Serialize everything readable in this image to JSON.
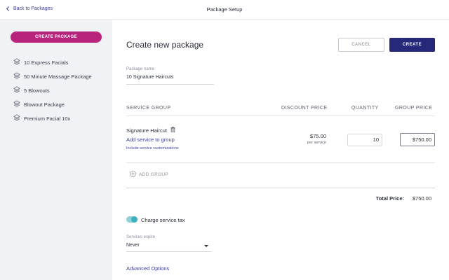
{
  "topbar": {
    "back_label": "Back to Packages",
    "title": "Package Setup"
  },
  "sidebar": {
    "create_button": "CREATE PACKAGE",
    "packages": [
      {
        "label": "10 Express Facials"
      },
      {
        "label": "50 Minute Massage Package"
      },
      {
        "label": "5 Blowouts"
      },
      {
        "label": "Blowout Package"
      },
      {
        "label": "Premium Facial 10x"
      }
    ]
  },
  "main": {
    "title": "Create new package",
    "cancel_label": "CANCEL",
    "create_label": "CREATE",
    "package_name_label": "Package name",
    "package_name_value": "10 Signature Haircuts",
    "columns": {
      "service_group": "SERVICE GROUP",
      "discount_price": "DISCOUNT PRICE",
      "quantity": "QUANTITY",
      "group_price": "GROUP PRICE"
    },
    "service": {
      "name": "Signature Haircut",
      "add_service": "Add service to group",
      "include_custom": "Include service customizations",
      "discount_price": "$75.00",
      "per_service": "per service",
      "quantity": "10",
      "group_price": "$750.00"
    },
    "add_group_label": "ADD GROUP",
    "total_label": "Total Price:",
    "total_value": "$750.00",
    "tax_toggle_label": "Charge service tax",
    "tax_toggle_on": true,
    "expires_label": "Services expire",
    "expires_value": "Never",
    "advanced_label": "Advanced Options"
  },
  "colors": {
    "accent_magenta": "#b8237b",
    "primary_navy": "#26287a",
    "link_blue": "#3b3f9a",
    "toggle_teal": "#3ab1bc",
    "sidebar_bg": "#f1f2f6"
  },
  "icons": {
    "back": "chevron-left-icon",
    "package": "layers-icon",
    "delete": "trash-icon",
    "add_group": "plus-circle-icon",
    "dropdown": "caret-down-icon"
  }
}
